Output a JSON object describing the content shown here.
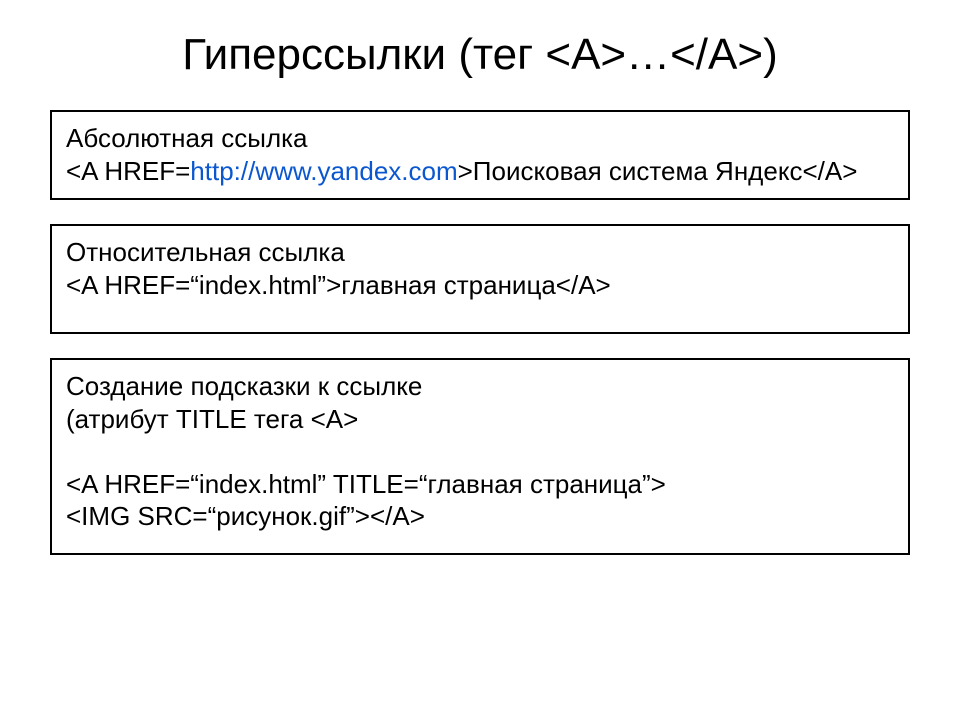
{
  "title": "Гиперссылки (тег <A>…</A>)",
  "box1": {
    "line1": "Абсолютная ссылка",
    "l2_a": "<A HREF=",
    "l2_url": "http://www.yandex.com",
    "l2_b": ">Поисковая система Яндекс</A>"
  },
  "box2": {
    "line1": "Относительная ссылка",
    "line2": "<A HREF=“index.html”>главная страница</A>"
  },
  "box3": {
    "line1": "Создание подсказки к ссылке",
    "line2": "(атрибут TITLE тега <A>",
    "line3": " ",
    "line4": "<A HREF=“index.html” TITLE=“главная страница”>",
    "line5": "<IMG SRC=“рисунок.gif”></A>"
  }
}
